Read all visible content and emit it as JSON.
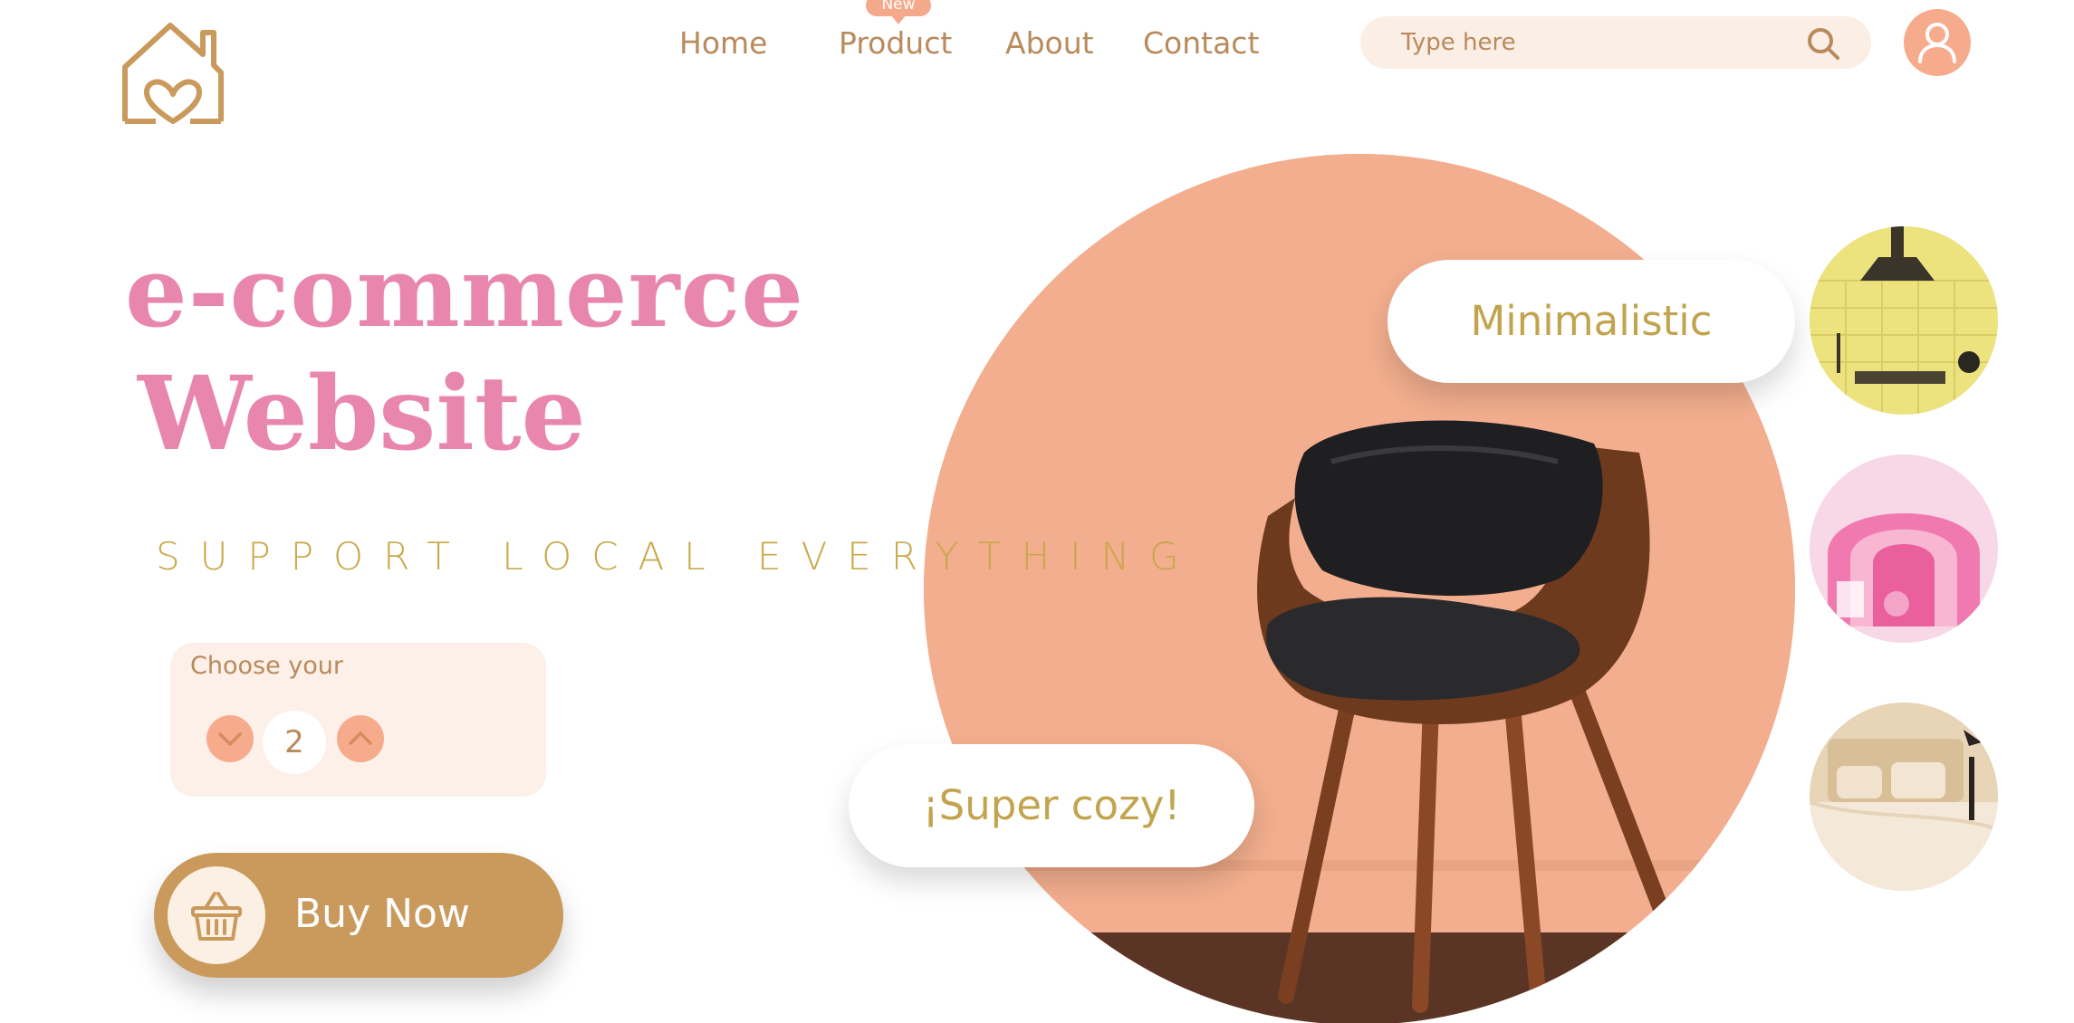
{
  "nav": {
    "items": [
      "Home",
      "Product",
      "About",
      "Contact"
    ],
    "badge": "New"
  },
  "search": {
    "placeholder": "Type here"
  },
  "hero": {
    "title_line1": "e-commerce",
    "title_line2": "Website",
    "tagline": "SUPPORT LOCAL EVERYTHING"
  },
  "quantity": {
    "label": "Choose your",
    "value": "2"
  },
  "buy": {
    "label": "Buy Now"
  },
  "tags": {
    "minimalistic": "Minimalistic",
    "cozy": "¡Super cozy!"
  },
  "thumbnails": [
    "kitchen-thumbnail",
    "pink-rainbow-thumbnail",
    "bedroom-thumbnail"
  ],
  "colors": {
    "accent_pink": "#e986ad",
    "brown": "#b88a5c",
    "gold": "#c9a84a",
    "peach": "#f2ae8e",
    "button": "#c99a5c",
    "cream": "#fcf0e8"
  },
  "icons": [
    "house-heart-logo-icon",
    "search-icon",
    "user-icon",
    "chevron-down-icon",
    "chevron-up-icon",
    "basket-icon"
  ]
}
